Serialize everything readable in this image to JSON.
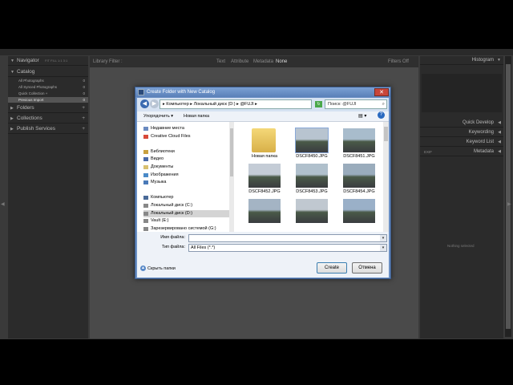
{
  "lightroom": {
    "left_panel": {
      "navigator": "Navigator",
      "navigator_zoom": "FIT  FILL  1:1  3:1",
      "catalog": "Catalog",
      "catalog_items": [
        {
          "label": "All Photographs",
          "count": "0"
        },
        {
          "label": "All Synced Photographs",
          "count": "0"
        },
        {
          "label": "Quick Collection  +",
          "count": "0"
        },
        {
          "label": "Previous Import",
          "count": "0"
        }
      ],
      "folders": "Folders",
      "collections": "Collections",
      "publish_services": "Publish Services"
    },
    "filter_bar": {
      "title": "Library Filter :",
      "text": "Text",
      "attribute": "Attribute",
      "metadata": "Metadata",
      "none": "None",
      "filters_off": "Filters Off"
    },
    "right_panel": {
      "histogram": "Histogram",
      "quick_develop": "Quick Develop",
      "keywording": "Keywording",
      "keyword_list": "Keyword List",
      "metadata": "Metadata",
      "metadata_preset": "EXIF",
      "no_photo": "Nothing selected"
    }
  },
  "dialog": {
    "title": "Create Folder with New Catalog",
    "close": "✕",
    "address": "▸ Компьютер ▸ Локальный диск (D:) ▸ @FUJI ▸",
    "search_placeholder": "Поиск: @FUJI",
    "organize": "Упорядочить ▾",
    "new_folder": "Новая папка",
    "tree": [
      {
        "label": "Недавние места",
        "icon": "recent-places-icon",
        "color": "#6a8ac0"
      },
      {
        "label": "Creative Cloud Files",
        "icon": "cloud-icon",
        "color": "#d84a3a"
      },
      {
        "label": "",
        "icon": "",
        "color": ""
      },
      {
        "label": "Библиотеки",
        "icon": "library-icon",
        "color": "#c8a040"
      },
      {
        "label": "Видео",
        "icon": "video-icon",
        "color": "#4a6aa8"
      },
      {
        "label": "Документы",
        "icon": "documents-icon",
        "color": "#d8c070"
      },
      {
        "label": "Изображения",
        "icon": "pictures-icon",
        "color": "#4a8ac8"
      },
      {
        "label": "Музыка",
        "icon": "music-icon",
        "color": "#4a7ab8"
      },
      {
        "label": "",
        "icon": "",
        "color": ""
      },
      {
        "label": "Компьютер",
        "icon": "computer-icon",
        "color": "#4a6a98"
      },
      {
        "label": "Локальный диск (C:)",
        "icon": "disk-icon",
        "color": "#888888"
      },
      {
        "label": "Локальный диск (D:)",
        "icon": "disk-icon",
        "color": "#888888"
      },
      {
        "label": "Vault (E:)",
        "icon": "disk-icon",
        "color": "#888888"
      },
      {
        "label": "Зарезервировано системой (G:)",
        "icon": "disk-icon",
        "color": "#888888"
      }
    ],
    "tree_selected_index": 11,
    "files": [
      {
        "name": "Новая папка",
        "kind": "folder"
      },
      {
        "name": "DSCF8450.JPG",
        "kind": "photo"
      },
      {
        "name": "DSCF8451.JPG",
        "kind": "photo"
      },
      {
        "name": "DSCF8452.JPG",
        "kind": "photo"
      },
      {
        "name": "DSCF8453.JPG",
        "kind": "photo"
      },
      {
        "name": "DSCF8454.JPG",
        "kind": "photo"
      },
      {
        "name": "",
        "kind": "photo"
      },
      {
        "name": "",
        "kind": "photo"
      },
      {
        "name": "",
        "kind": "photo"
      }
    ],
    "filename_label": "Имя файла:",
    "filename_value": "",
    "filetype_label": "Тип файла:",
    "filetype_value": "All Files (*.*)",
    "hide_folders": "Скрыть папки",
    "create": "Create",
    "cancel": "Отмена"
  }
}
